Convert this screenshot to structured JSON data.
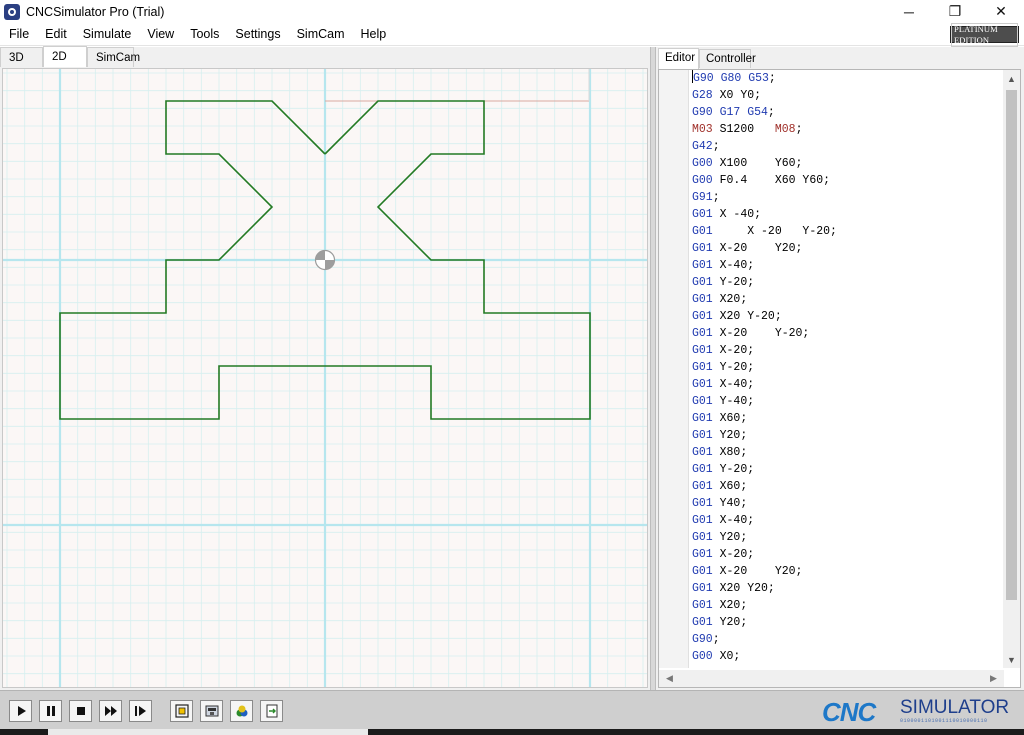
{
  "window": {
    "title": "CNCSimulator Pro (Trial)",
    "minimize": "─",
    "maximize": "❐",
    "close": "✕"
  },
  "menu": {
    "items": [
      "File",
      "Edit",
      "Simulate",
      "View",
      "Tools",
      "Settings",
      "SimCam",
      "Help"
    ],
    "edition_badge": "PLATINUM EDITION"
  },
  "left_tabs": [
    "3D",
    "2D",
    "SimCam"
  ],
  "right_tabs": [
    "Editor",
    "Controller"
  ],
  "colors": {
    "grid_fine": "#d6efef",
    "grid_axis": "#b6e6ee",
    "canvas_bg": "#fbf7f6",
    "toolpath": "#237a23",
    "feed_line": "#d9a8a0",
    "code_keyword": "#1f3ab0",
    "code_m": "#a0302a"
  },
  "toolbar": {
    "buttons": [
      {
        "name": "play-button",
        "icon": "play-icon"
      },
      {
        "name": "pause-button",
        "icon": "pause-icon"
      },
      {
        "name": "stop-button",
        "icon": "stop-icon"
      },
      {
        "name": "fast-forward-button",
        "icon": "fast-forward-icon"
      },
      {
        "name": "step-button",
        "icon": "step-icon"
      },
      {
        "name": "fit-view-button",
        "icon": "fit-view-icon"
      },
      {
        "name": "machine-button",
        "icon": "machine-icon"
      },
      {
        "name": "materials-button",
        "icon": "materials-icon"
      },
      {
        "name": "export-button",
        "icon": "export-icon"
      }
    ]
  },
  "brand": {
    "cnc": "CNC",
    "simulator": "SIMULATOR",
    "binary": "0100001101001110010000110"
  },
  "code_lines": [
    [
      [
        "G90 G80 G53",
        "b"
      ],
      [
        ";",
        "t"
      ]
    ],
    [
      [
        "G28",
        "b"
      ],
      [
        " X0 Y0;",
        "t"
      ]
    ],
    [
      [
        "G90 G17 G54",
        "b"
      ],
      [
        ";",
        "t"
      ]
    ],
    [
      [
        "M03",
        "r"
      ],
      [
        " S1200   ",
        "t"
      ],
      [
        "M08",
        "r"
      ],
      [
        ";",
        "t"
      ]
    ],
    [
      [
        "G42",
        "b"
      ],
      [
        ";",
        "t"
      ]
    ],
    [
      [
        "G00",
        "b"
      ],
      [
        " X100    Y60;",
        "t"
      ]
    ],
    [
      [
        "G00",
        "b"
      ],
      [
        " F0.4    X60 Y60;",
        "t"
      ]
    ],
    [
      [
        "G91",
        "b"
      ],
      [
        ";",
        "t"
      ]
    ],
    [
      [
        "G01",
        "b"
      ],
      [
        " X -40;",
        "t"
      ]
    ],
    [
      [
        "G01",
        "b"
      ],
      [
        "     X -20   Y-20;",
        "t"
      ]
    ],
    [
      [
        "G01",
        "b"
      ],
      [
        " X-20    Y20;",
        "t"
      ]
    ],
    [
      [
        "G01",
        "b"
      ],
      [
        " X-40;",
        "t"
      ]
    ],
    [
      [
        "G01",
        "b"
      ],
      [
        " Y-20;",
        "t"
      ]
    ],
    [
      [
        "G01",
        "b"
      ],
      [
        " X20;",
        "t"
      ]
    ],
    [
      [
        "G01",
        "b"
      ],
      [
        " X20 Y-20;",
        "t"
      ]
    ],
    [
      [
        "G01",
        "b"
      ],
      [
        " X-20    Y-20;",
        "t"
      ]
    ],
    [
      [
        "G01",
        "b"
      ],
      [
        " X-20;",
        "t"
      ]
    ],
    [
      [
        "G01",
        "b"
      ],
      [
        " Y-20;",
        "t"
      ]
    ],
    [
      [
        "G01",
        "b"
      ],
      [
        " X-40;",
        "t"
      ]
    ],
    [
      [
        "G01",
        "b"
      ],
      [
        " Y-40;",
        "t"
      ]
    ],
    [
      [
        "G01",
        "b"
      ],
      [
        " X60;",
        "t"
      ]
    ],
    [
      [
        "G01",
        "b"
      ],
      [
        " Y20;",
        "t"
      ]
    ],
    [
      [
        "G01",
        "b"
      ],
      [
        " X80;",
        "t"
      ]
    ],
    [
      [
        "G01",
        "b"
      ],
      [
        " Y-20;",
        "t"
      ]
    ],
    [
      [
        "G01",
        "b"
      ],
      [
        " X60;",
        "t"
      ]
    ],
    [
      [
        "G01",
        "b"
      ],
      [
        " Y40;",
        "t"
      ]
    ],
    [
      [
        "G01",
        "b"
      ],
      [
        " X-40;",
        "t"
      ]
    ],
    [
      [
        "G01",
        "b"
      ],
      [
        " Y20;",
        "t"
      ]
    ],
    [
      [
        "G01",
        "b"
      ],
      [
        " X-20;",
        "t"
      ]
    ],
    [
      [
        "G01",
        "b"
      ],
      [
        " X-20    Y20;",
        "t"
      ]
    ],
    [
      [
        "G01",
        "b"
      ],
      [
        " X20 Y20;",
        "t"
      ]
    ],
    [
      [
        "G01",
        "b"
      ],
      [
        " X20;",
        "t"
      ]
    ],
    [
      [
        "G01",
        "b"
      ],
      [
        " Y20;",
        "t"
      ]
    ],
    [
      [
        "G90",
        "b"
      ],
      [
        ";",
        "t"
      ]
    ],
    [
      [
        "G00",
        "b"
      ],
      [
        " X0;",
        "t"
      ]
    ]
  ]
}
